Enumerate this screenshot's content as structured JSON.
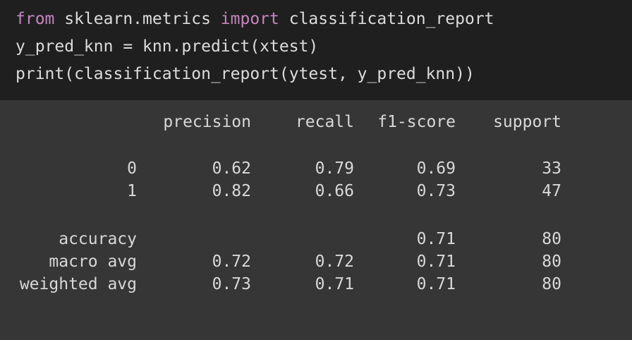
{
  "code": {
    "line1": {
      "kw_from": "from",
      "module": " sklearn.metrics ",
      "kw_import": "import",
      "name": " classification_report"
    },
    "line2": "y_pred_knn = knn.predict(xtest)",
    "line3": "print(classification_report(ytest, y_pred_knn))"
  },
  "colors": {
    "code_bg": "#1f1f1f",
    "output_bg": "#363636",
    "keyword": "#c586c0",
    "text": "#dcdcdc"
  },
  "report": {
    "headers": [
      "precision",
      "recall",
      "f1-score",
      "support"
    ],
    "rows": [
      {
        "label": "0",
        "precision": "0.62",
        "recall": "0.79",
        "f1": "0.69",
        "support": "33"
      },
      {
        "label": "1",
        "precision": "0.82",
        "recall": "0.66",
        "f1": "0.73",
        "support": "47"
      },
      {
        "label": "accuracy",
        "precision": "",
        "recall": "",
        "f1": "0.71",
        "support": "80"
      },
      {
        "label": "macro avg",
        "precision": "0.72",
        "recall": "0.72",
        "f1": "0.71",
        "support": "80"
      },
      {
        "label": "weighted avg",
        "precision": "0.73",
        "recall": "0.71",
        "f1": "0.71",
        "support": "80"
      }
    ]
  }
}
